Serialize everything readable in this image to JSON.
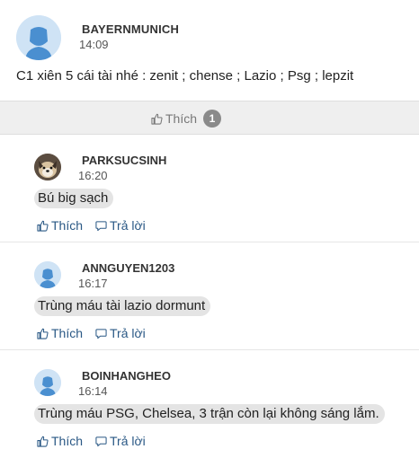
{
  "post": {
    "username": "BAYERNMUNICH",
    "time": "14:09",
    "content": "C1 xiên 5 cái tài nhé : zenit ; chense ; Lazio ; Psg ; lepzit",
    "like_label": "Thích",
    "like_count": "1"
  },
  "replies": [
    {
      "username": "PARKSUCSINH",
      "time": "16:20",
      "content": "Bú big sạch",
      "avatar_icon": "dog-photo-avatar",
      "like_label": "Thích",
      "reply_label": "Trả lời"
    },
    {
      "username": "ANNGUYEN1203",
      "time": "16:17",
      "content": "Trùng máu tài lazio dormunt",
      "avatar_icon": "default-user-avatar",
      "like_label": "Thích",
      "reply_label": "Trả lời"
    },
    {
      "username": "BOINHANGHEO",
      "time": "16:14",
      "content": "Trùng máu PSG, Chelsea, 3 trận còn lại không sáng lắm.",
      "avatar_icon": "default-user-avatar",
      "like_label": "Thích",
      "reply_label": "Trả lời"
    }
  ],
  "colors": {
    "link": "#2a5885",
    "bubble": "#e4e4e4",
    "like_bar": "#efefef",
    "avatar_bg": "#cfe3f5"
  }
}
